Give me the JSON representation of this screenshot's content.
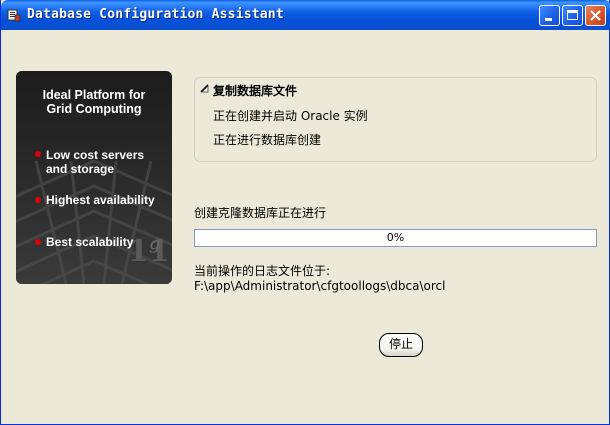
{
  "window": {
    "title": "Database Configuration Assistant",
    "controls": [
      "minimize-icon",
      "maximize-icon",
      "close-icon"
    ]
  },
  "side_panel": {
    "title_line1": "Ideal Platform for",
    "title_line2": "Grid Computing",
    "items": [
      {
        "line1": "Low cost servers",
        "line2": "and storage"
      },
      {
        "line1": "Highest availability",
        "line2": ""
      },
      {
        "line1": "Best scalability",
        "line2": ""
      }
    ],
    "logo_text": "11g"
  },
  "steps": [
    {
      "label": "复制数据库文件",
      "state": "current"
    },
    {
      "label": "正在创建并启动 Oracle 实例",
      "state": "pending"
    },
    {
      "label": "正在进行数据库创建",
      "state": "pending"
    }
  ],
  "progress": {
    "label": "创建克隆数据库正在进行",
    "percent_text": "0%",
    "fraction": 0
  },
  "log": {
    "label": "当前操作的日志文件位于:",
    "path": "F:\\app\\Administrator\\cfgtoollogs\\dbca\\orcl"
  },
  "buttons": {
    "stop": "停止"
  },
  "colors": {
    "titlebar": "#0a5ee0",
    "window_bg": "#ece9d8",
    "panel_bg": "#1c1c1c",
    "bullet": "#e00000"
  }
}
